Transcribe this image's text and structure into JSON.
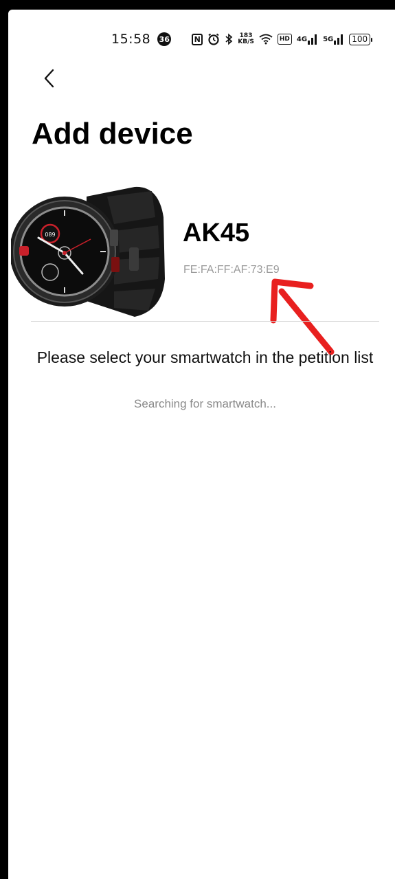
{
  "status_bar": {
    "time": "15:58",
    "notification_count": "36",
    "nfc_label": "N",
    "network_speed_value": "183",
    "network_speed_unit": "KB/S",
    "hd_label": "HD",
    "signal_1_label": "4G",
    "signal_2_label": "5G",
    "battery_level": "100",
    "icons": [
      "nfc-icon",
      "alarm-icon",
      "bluetooth-icon",
      "wifi-icon",
      "hd-voice-icon",
      "signal-icon",
      "signal-icon",
      "battery-icon"
    ]
  },
  "header": {
    "title": "Add device"
  },
  "device": {
    "name": "AK45",
    "mac": "FE:FA:FF:AF:73:E9"
  },
  "main": {
    "prompt": "Please select your smartwatch in the petition list",
    "status": "Searching for smartwatch..."
  },
  "colors": {
    "annotation_arrow": "#e8201f",
    "divider": "#d4d4d4",
    "secondary_text": "#9a9a9a"
  }
}
